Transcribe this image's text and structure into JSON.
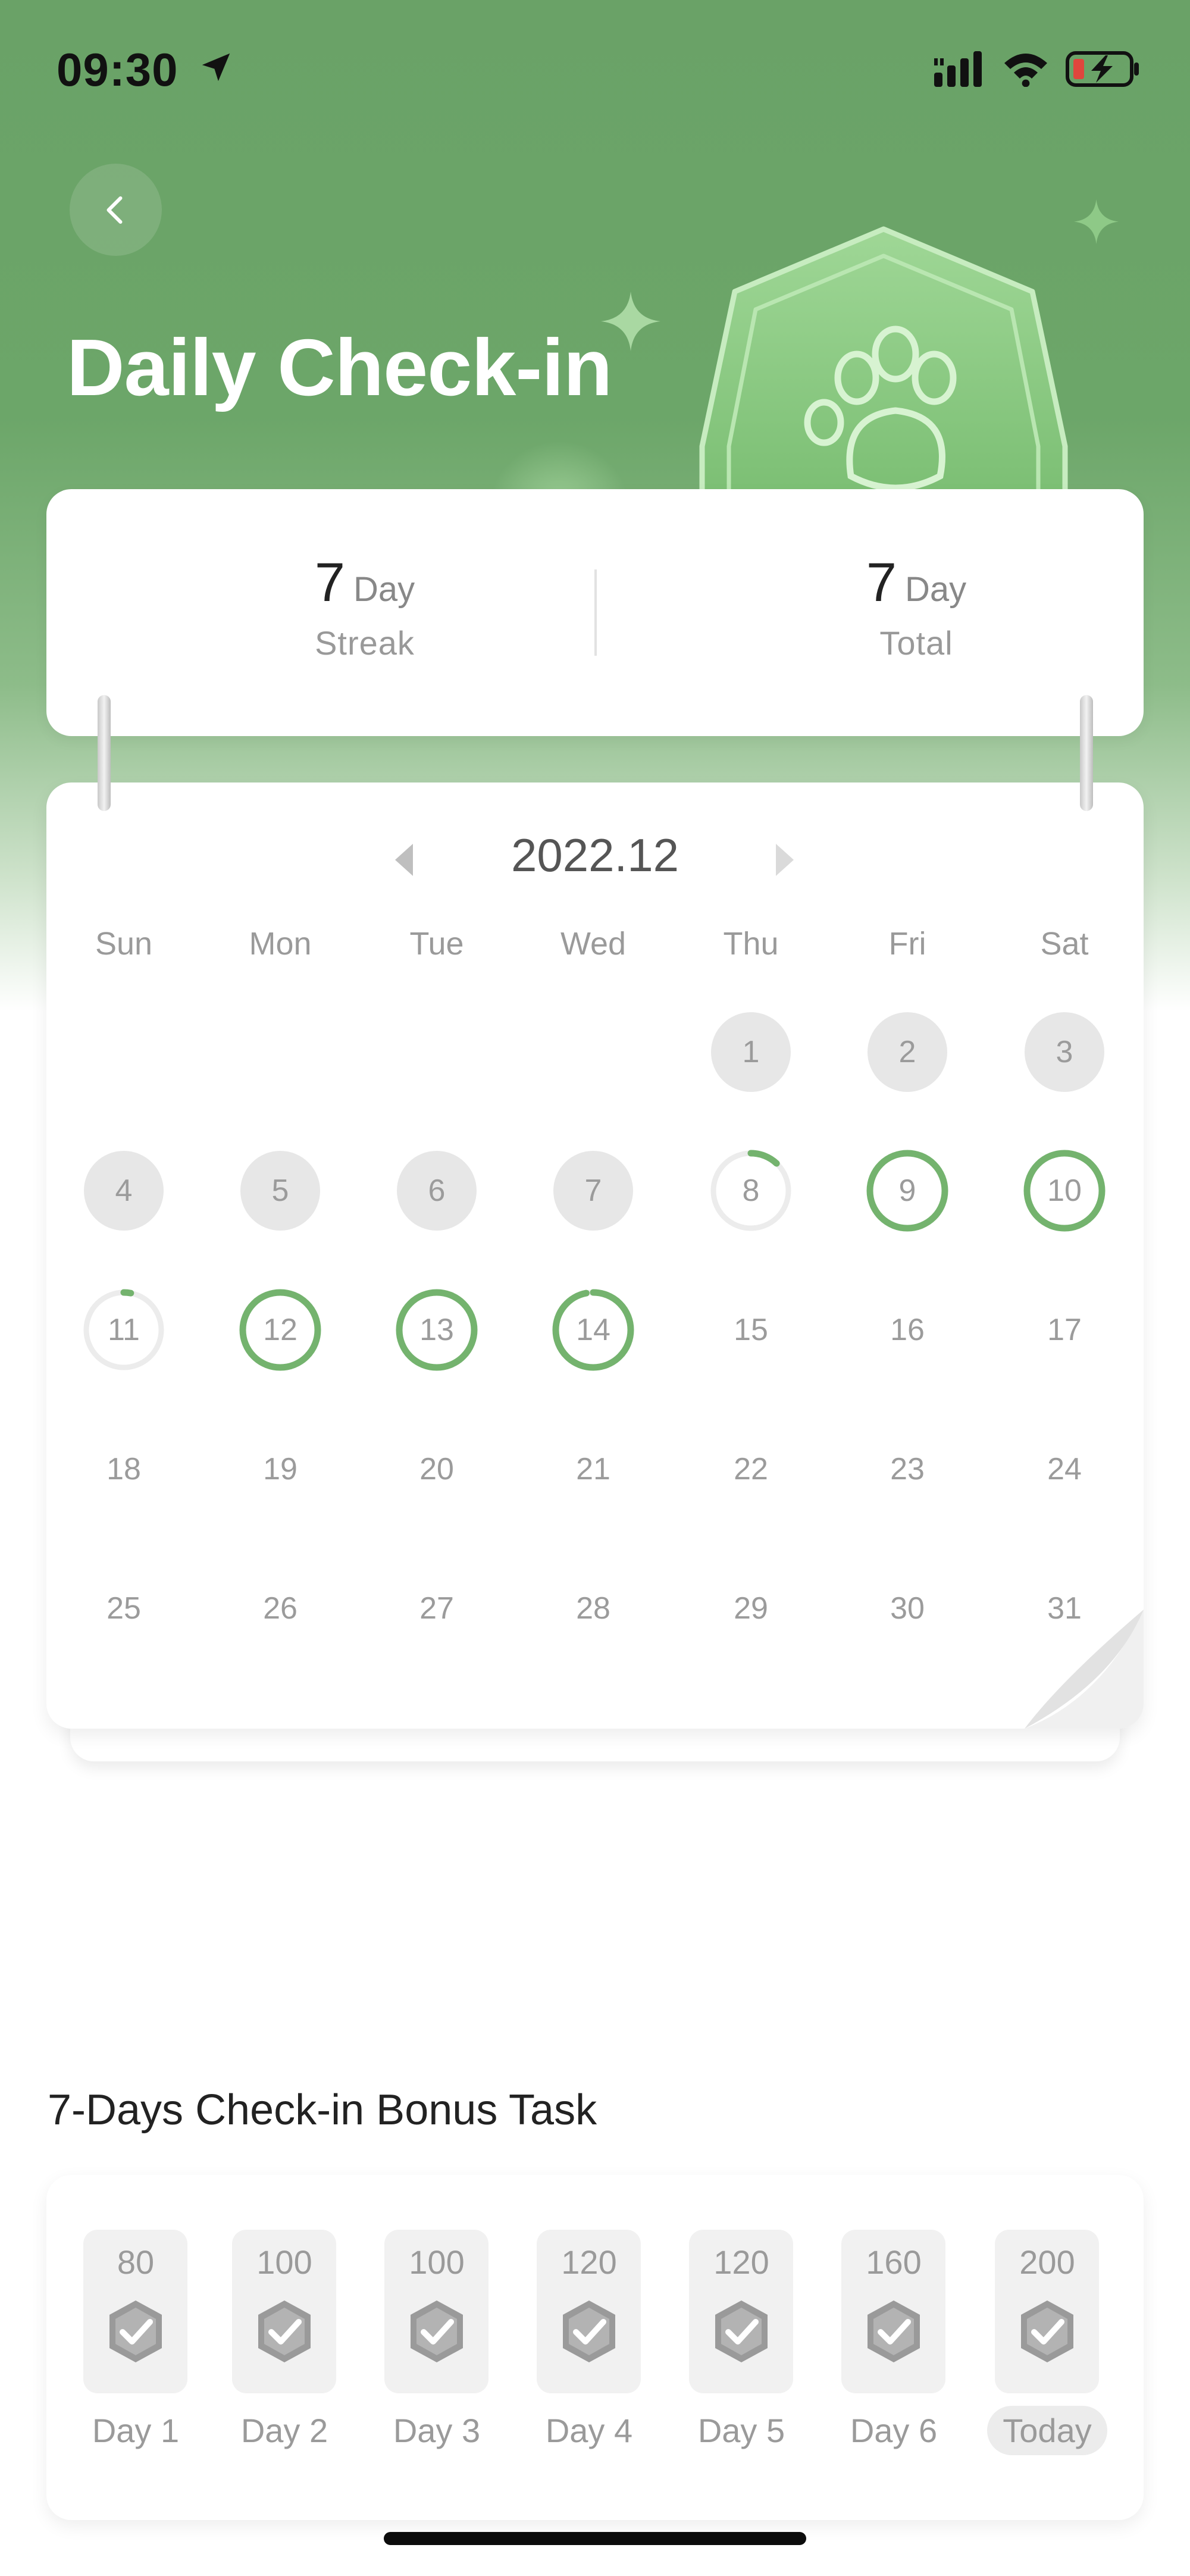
{
  "status_bar": {
    "time": "09:30",
    "icons": [
      "location-arrow-icon",
      "signal-icon",
      "wifi-icon",
      "battery-charging-icon"
    ]
  },
  "header": {
    "title": "Daily Check-in",
    "back_icon": "chevron-left-icon",
    "badge_icon": "paw-badge-icon"
  },
  "stats": {
    "streak": {
      "value": "7",
      "unit": "Day",
      "label": "Streak"
    },
    "total": {
      "value": "7",
      "unit": "Day",
      "label": "Total"
    }
  },
  "calendar": {
    "month": "2022.12",
    "weekdays": [
      "Sun",
      "Mon",
      "Tue",
      "Wed",
      "Thu",
      "Fri",
      "Sat"
    ],
    "first_weekday_index": 4,
    "days_in_month": 31,
    "accent_color": "#74b36e",
    "missed_color": "#e7e7e7",
    "days": [
      {
        "d": "1",
        "state": "missed"
      },
      {
        "d": "2",
        "state": "missed"
      },
      {
        "d": "3",
        "state": "missed"
      },
      {
        "d": "4",
        "state": "missed"
      },
      {
        "d": "5",
        "state": "missed"
      },
      {
        "d": "6",
        "state": "missed"
      },
      {
        "d": "7",
        "state": "missed"
      },
      {
        "d": "8",
        "state": "partial",
        "progress": 0.12
      },
      {
        "d": "9",
        "state": "checked"
      },
      {
        "d": "10",
        "state": "checked"
      },
      {
        "d": "11",
        "state": "partial",
        "progress": 0.03
      },
      {
        "d": "12",
        "state": "checked"
      },
      {
        "d": "13",
        "state": "checked"
      },
      {
        "d": "14",
        "state": "partial",
        "progress": 0.97
      },
      {
        "d": "15",
        "state": "future"
      },
      {
        "d": "16",
        "state": "future"
      },
      {
        "d": "17",
        "state": "future"
      },
      {
        "d": "18",
        "state": "future"
      },
      {
        "d": "19",
        "state": "future"
      },
      {
        "d": "20",
        "state": "future"
      },
      {
        "d": "21",
        "state": "future"
      },
      {
        "d": "22",
        "state": "future"
      },
      {
        "d": "23",
        "state": "future"
      },
      {
        "d": "24",
        "state": "future"
      },
      {
        "d": "25",
        "state": "future"
      },
      {
        "d": "26",
        "state": "future"
      },
      {
        "d": "27",
        "state": "future"
      },
      {
        "d": "28",
        "state": "future"
      },
      {
        "d": "29",
        "state": "future"
      },
      {
        "d": "30",
        "state": "future"
      },
      {
        "d": "31",
        "state": "future"
      }
    ]
  },
  "bonus": {
    "title": "7-Days Check-in Bonus Task",
    "tasks": [
      {
        "points": "80",
        "label": "Day 1"
      },
      {
        "points": "100",
        "label": "Day 2"
      },
      {
        "points": "100",
        "label": "Day 3"
      },
      {
        "points": "120",
        "label": "Day 4"
      },
      {
        "points": "120",
        "label": "Day 5"
      },
      {
        "points": "160",
        "label": "Day 6"
      },
      {
        "points": "200",
        "label": "Today",
        "highlight": true
      }
    ]
  }
}
